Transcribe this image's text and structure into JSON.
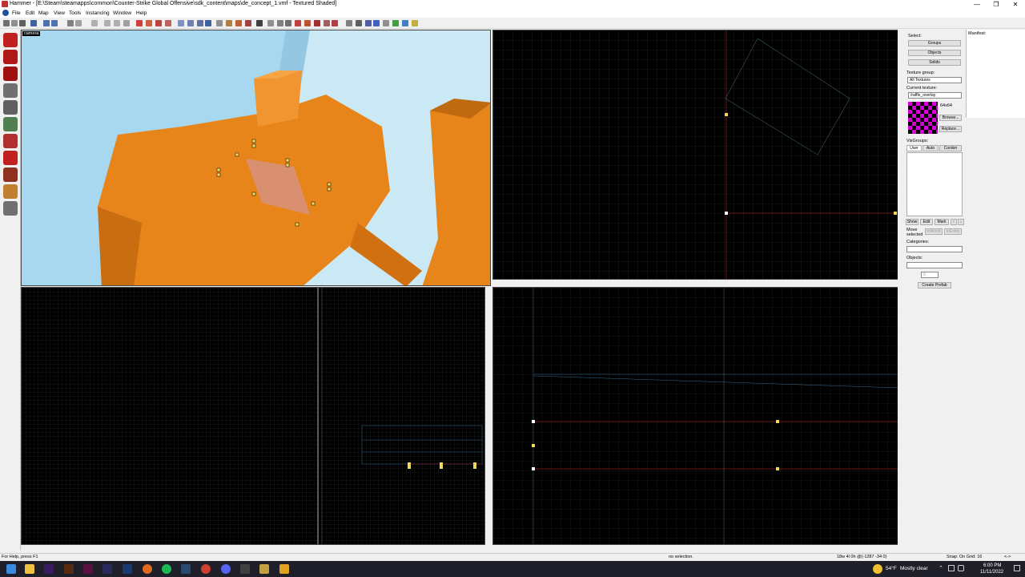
{
  "window": {
    "title": "Hammer - [E:\\Steam\\steamapps\\common\\Counter-Strike Global Offensive\\sdk_content\\maps\\de_concept_1.vmf - Textured Shaded]",
    "controls": [
      "—",
      "❐",
      "✕"
    ]
  },
  "menubar": {
    "items": [
      "File",
      "Edit",
      "Map",
      "View",
      "Tools",
      "Instancing",
      "Window",
      "Help"
    ]
  },
  "camera_view": {
    "label": "camera"
  },
  "right_panel": {
    "select_label": "Select:",
    "buttons": [
      "Groups",
      "Objects",
      "Solids"
    ],
    "texture_group_label": "Texture group:",
    "texture_group_value": "All Textures",
    "current_texture_label": "Current texture:",
    "current_texture_value": "/raffle_overlay",
    "texture_size": "64x64",
    "browse_label": "Browse...",
    "replace_label": "Replace...",
    "visgroups_label": "VisGroups:",
    "visgroup_tabs": [
      "User",
      "Auto",
      "Cordon"
    ],
    "visgroup_actions": [
      "Show",
      "Edit",
      "Mark",
      "↑",
      "↓"
    ],
    "move_selected_label": "Move selected",
    "to_world_label": "toWorld",
    "to_entity_label": "toEntity",
    "categories_label": "Categories:",
    "objects_label": "Objects:",
    "objects_count": "0",
    "create_prefab_label": "Create Prefab"
  },
  "manifest": {
    "label": "Manifest:"
  },
  "statusbar": {
    "help": "For Help, press F1",
    "selection": "no selection.",
    "coords": "18w 4l 0h @(-1287 -34 0)",
    "snap": "Snap: On Grid: 16",
    "arrows": "<->"
  },
  "taskbar": {
    "weather_temp": "54°F",
    "weather_desc": "Mostly clear",
    "time": "6:00 PM",
    "date": "11/11/2022"
  },
  "colors": {
    "accent_orange": "#e8851a",
    "sky_blue": "#a8d8f0",
    "grid_line": "#2a2a2a",
    "axis_red": "#8a1a1a",
    "selection_yellow": "#f0d860",
    "texture_magenta": "#d800d8"
  }
}
